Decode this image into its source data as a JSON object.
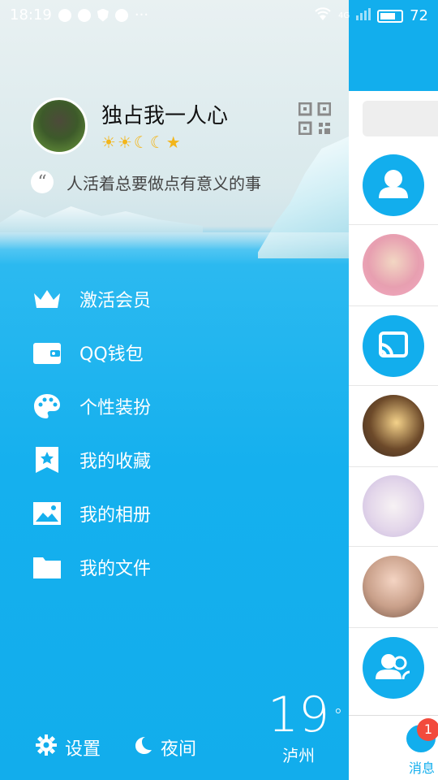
{
  "status_bar": {
    "time": "18:19",
    "network": "4G",
    "battery": "72",
    "icons": [
      "message-icon",
      "app-icon",
      "shield-icon",
      "sync-icon",
      "more-icon",
      "wifi-icon",
      "signal-icon",
      "battery-icon"
    ]
  },
  "profile": {
    "name": "独占我一人心",
    "level_icons": [
      "☀",
      "☀",
      "☾",
      "☾",
      "★"
    ],
    "signature": "人活着总要做点有意义的事",
    "quote_glyph": "“"
  },
  "menu": [
    {
      "label": "激活会员",
      "icon": "crown-icon"
    },
    {
      "label": "QQ钱包",
      "icon": "wallet-icon"
    },
    {
      "label": "个性装扮",
      "icon": "palette-icon"
    },
    {
      "label": "我的收藏",
      "icon": "favorite-icon"
    },
    {
      "label": "我的相册",
      "icon": "album-icon"
    },
    {
      "label": "我的文件",
      "icon": "folder-icon"
    }
  ],
  "bottom": {
    "settings": "设置",
    "night": "夜间"
  },
  "weather": {
    "temp": "19",
    "unit": "°",
    "city": "泸州"
  },
  "tabbar": {
    "messages_label": "消息",
    "badge": "1"
  },
  "colors": {
    "accent": "#12aeed",
    "badge": "#f24a3c"
  }
}
